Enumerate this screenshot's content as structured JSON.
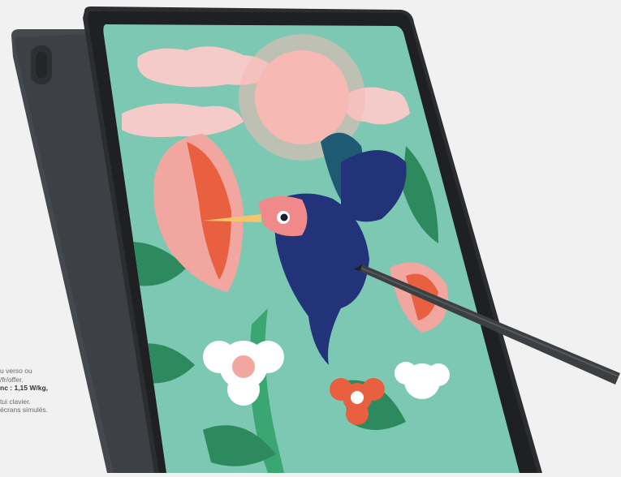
{
  "legal": {
    "line1": "u verso ou",
    "line2": "/fr/offer.",
    "line3": "nc : 1,15 W/kg,",
    "line4": "tui clavier.",
    "line5": "écrans simulés."
  },
  "colors": {
    "background": "#f1f1f1",
    "tablet_body": "#3a3d40",
    "screen_bg": "#7cc8b3",
    "sun": "#f6b9b4",
    "bird": "#22337a",
    "flower_red": "#e8603f",
    "stylus": "#3c3f42"
  },
  "product": {
    "visual": "tablet-with-stylus-illustration"
  }
}
